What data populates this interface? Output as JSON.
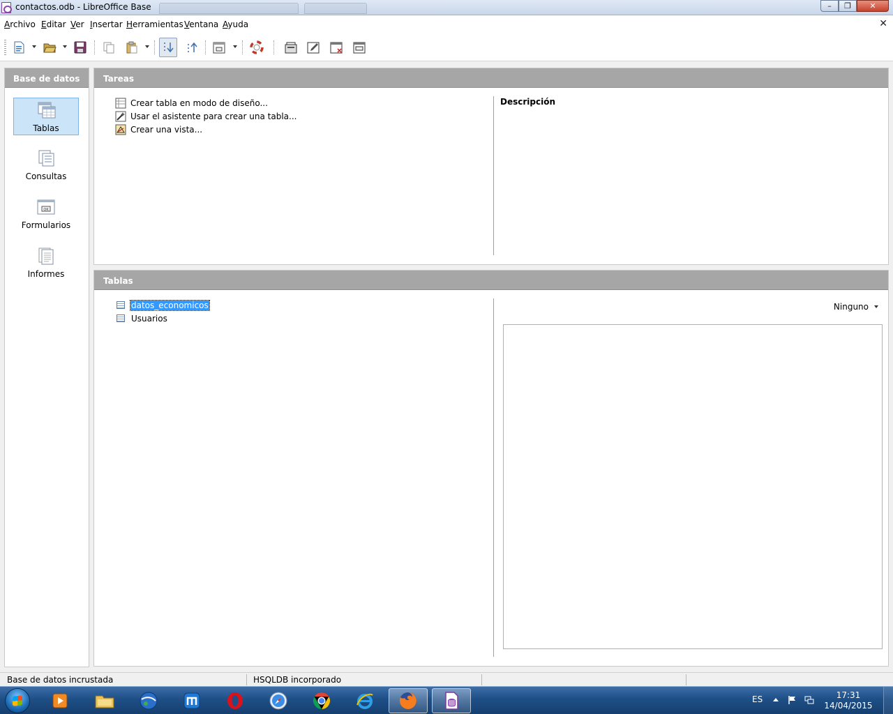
{
  "window": {
    "title": "contactos.odb - LibreOffice Base"
  },
  "menu": {
    "items": [
      "Archivo",
      "Editar",
      "Ver",
      "Insertar",
      "Herramientas",
      "Ventana",
      "Ayuda"
    ]
  },
  "left_panel": {
    "header": "Base de datos",
    "items": [
      {
        "label": "Tablas",
        "icon": "tables-icon",
        "selected": true
      },
      {
        "label": "Consultas",
        "icon": "queries-icon",
        "selected": false
      },
      {
        "label": "Formularios",
        "icon": "forms-icon",
        "selected": false
      },
      {
        "label": "Informes",
        "icon": "reports-icon",
        "selected": false
      }
    ]
  },
  "tasks": {
    "header": "Tareas",
    "items": [
      {
        "label": "Crear tabla en modo de diseño...",
        "icon": "design-table-icon"
      },
      {
        "label": "Usar el asistente para crear una tabla...",
        "icon": "wizard-icon"
      },
      {
        "label": "Crear una vista...",
        "icon": "create-view-icon"
      }
    ],
    "description_title": "Descripción"
  },
  "tables": {
    "header": "Tablas",
    "items": [
      {
        "label": "datos_economicos",
        "selected": true
      },
      {
        "label": "Usuarios",
        "selected": false
      }
    ],
    "preview_mode": "Ninguno"
  },
  "status": {
    "left": "Base de datos incrustada",
    "middle": "HSQLDB incorporado"
  },
  "taskbar": {
    "language": "ES",
    "time": "17:31",
    "date": "14/04/2015",
    "apps": [
      "media-player-icon",
      "file-explorer-icon",
      "google-earth-icon",
      "maxthon-icon",
      "opera-icon",
      "safari-icon",
      "chrome-icon",
      "internet-explorer-icon",
      "firefox-icon",
      "libreoffice-base-icon"
    ]
  },
  "colors": {
    "panel_header": "#a6a6a6",
    "selection": "#3399ff",
    "nav_selected": "#cce4f7"
  }
}
